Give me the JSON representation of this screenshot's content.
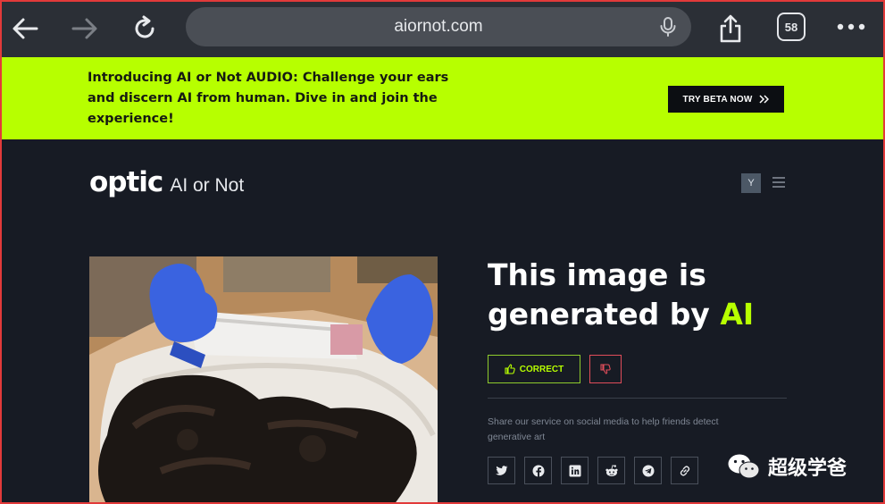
{
  "browser": {
    "url": "aiornot.com",
    "tabs_count": "58"
  },
  "banner": {
    "message": "Introducing AI or Not AUDIO: Challenge your ears and discern AI from human. Dive in and join the experience!",
    "cta_label": "TRY BETA NOW"
  },
  "header": {
    "logo_brand": "optic",
    "logo_product": "AI or Not",
    "avatar_initial": "Y"
  },
  "result": {
    "headline_prefix": "This image is generated by",
    "headline_highlight": "AI",
    "correct_label": "CORRECT"
  },
  "share": {
    "text": "Share our service on social media to help friends detect generative art",
    "icons": [
      "twitter-icon",
      "facebook-icon",
      "linkedin-icon",
      "reddit-icon",
      "telegram-icon",
      "link-icon"
    ]
  },
  "watermark": {
    "text": "超级学爸"
  },
  "colors": {
    "accent": "#b7ff00",
    "page_bg": "#171b24",
    "error": "#e04d5a",
    "frame": "#e23a3a"
  }
}
